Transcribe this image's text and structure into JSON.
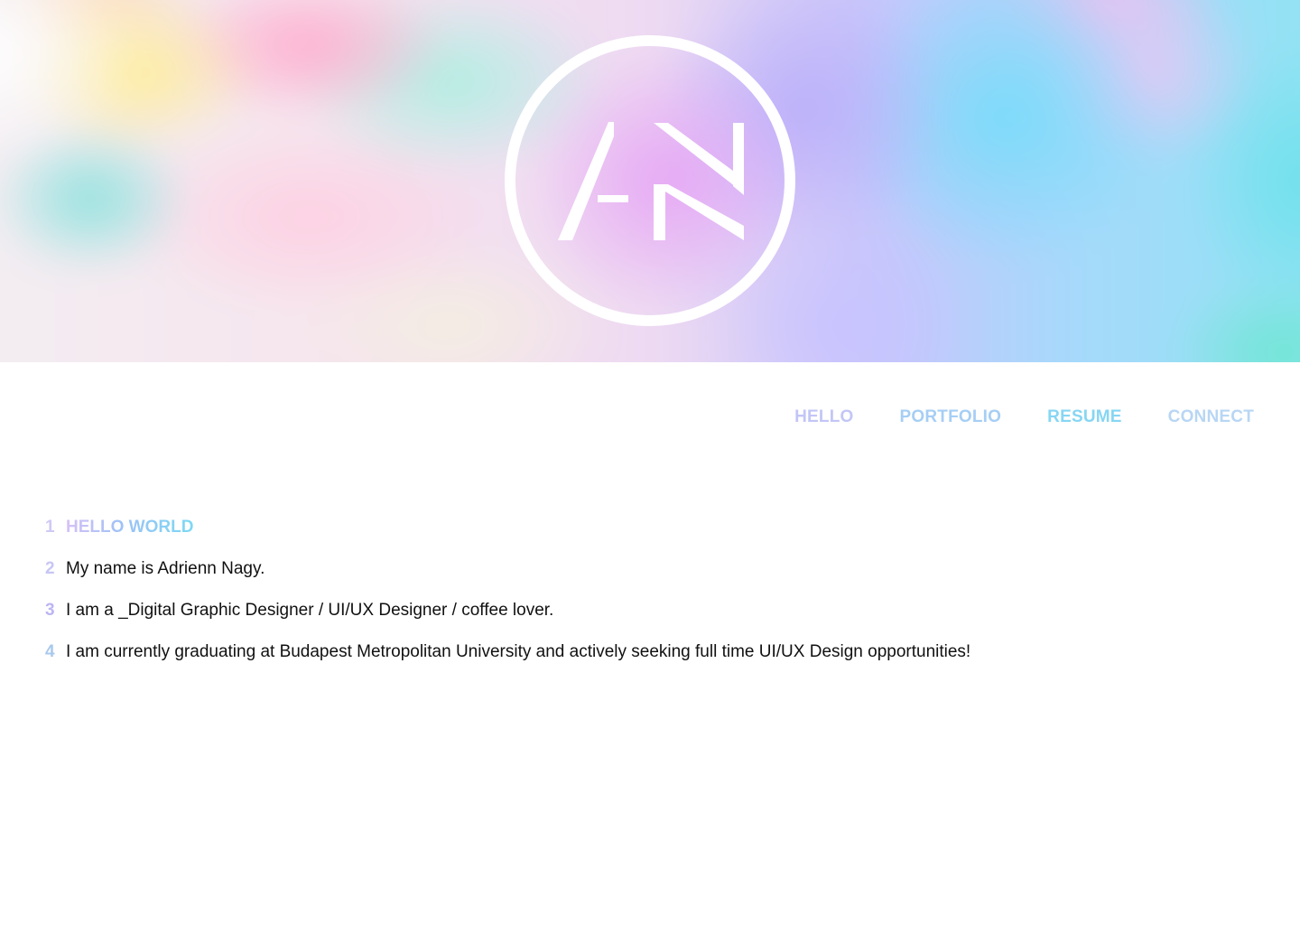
{
  "colors": {
    "nav_hello": "#c2c6f6",
    "nav_portfolio": "#a6cef5",
    "nav_resume": "#86d6f3",
    "nav_connect": "#b8d6f4",
    "num_1": "#cfc9f6",
    "num_2": "#c7c6f4",
    "num_3": "#bcb5f3",
    "num_4": "#a9c9ed",
    "body_text": "#111111",
    "logo_stroke": "#ffffff"
  },
  "hero": {
    "logo_icon": "an-monogram-circle-icon"
  },
  "nav": {
    "items": [
      {
        "label": "HELLO"
      },
      {
        "label": "PORTFOLIO"
      },
      {
        "label": "RESUME"
      },
      {
        "label": "CONNECT"
      }
    ]
  },
  "intro": {
    "lines": [
      {
        "num": "1",
        "text": "HELLO WORLD"
      },
      {
        "num": "2",
        "text": "My name is Adrienn Nagy."
      },
      {
        "num": "3",
        "text": "I am a _Digital Graphic Designer / UI/UX Designer / coffee lover."
      },
      {
        "num": "4",
        "text": "I am currently graduating at Budapest Metropolitan University and actively seeking full time UI/UX Design opportunities!"
      }
    ]
  }
}
